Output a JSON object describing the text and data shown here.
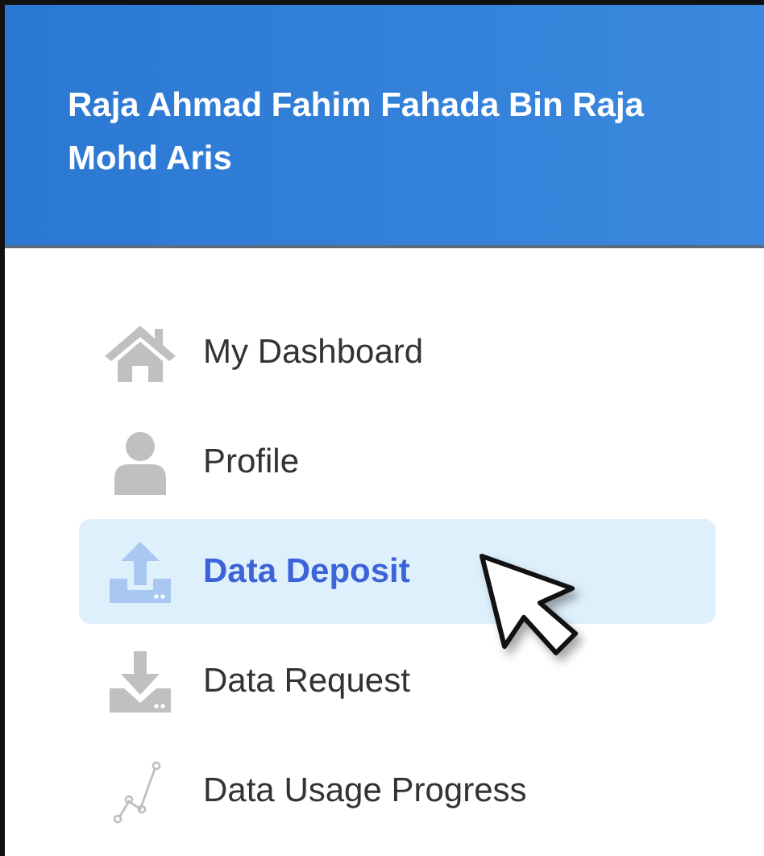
{
  "header": {
    "user_name": "Raja Ahmad Fahim Fahada Bin Raja Mohd Aris"
  },
  "menu": [
    {
      "label": "My Dashboard",
      "kind": "home",
      "selected": false
    },
    {
      "label": "Profile",
      "kind": "user",
      "selected": false
    },
    {
      "label": "Data Deposit",
      "kind": "upload",
      "selected": true
    },
    {
      "label": "Data Request",
      "kind": "download",
      "selected": false
    },
    {
      "label": "Data Usage Progress",
      "kind": "progress",
      "selected": false
    }
  ]
}
